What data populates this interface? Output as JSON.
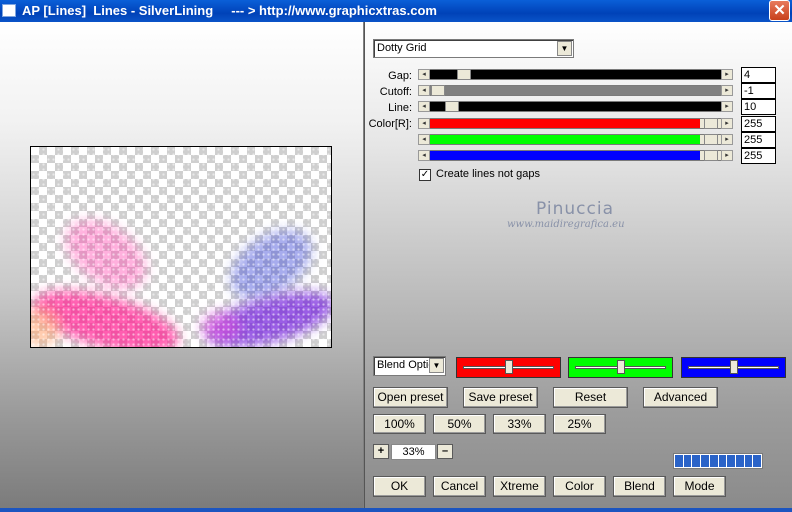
{
  "window": {
    "title": "AP [Lines]  Lines - SilverLining     --- > http://www.graphicxtras.com",
    "close_glyph": "✕"
  },
  "effect_select": {
    "value": "Dotty Grid"
  },
  "params": {
    "gap": {
      "label": "Gap:",
      "value": "4"
    },
    "cutoff": {
      "label": "Cutoff:",
      "value": "-1"
    },
    "line": {
      "label": "Line:",
      "value": "10"
    },
    "color": {
      "label": "Color[R]:",
      "r": "255",
      "g": "255",
      "b": "255"
    }
  },
  "option": {
    "label": "Create lines not gaps",
    "checked": true,
    "check_glyph": "✓"
  },
  "watermark": {
    "name": "Pinuccia",
    "site": "www.maidiregrafica.eu"
  },
  "blend_select": {
    "value": "Blend Optio"
  },
  "channel_sliders": {
    "red": {
      "color": "#ff0000",
      "level": 0.5
    },
    "green": {
      "color": "#00ff00",
      "level": 0.5
    },
    "blue": {
      "color": "#0000ff",
      "level": 0.5
    }
  },
  "buttons": {
    "open_preset": "Open preset",
    "save_preset": "Save preset",
    "reset": "Reset",
    "advanced": "Advanced",
    "zoom100": "100%",
    "zoom50": "50%",
    "zoom33": "33%",
    "zoom25": "25%",
    "zoom_in": "+",
    "zoom_out": "–",
    "ok": "OK",
    "cancel": "Cancel",
    "xtreme": "Xtreme",
    "color": "Color",
    "blend": "Blend",
    "mode": "Mode"
  },
  "zoom": {
    "value": "33%"
  },
  "arrows": {
    "down": "▼",
    "left": "◂",
    "right": "▸"
  },
  "colors": {
    "title_bar": "#0a54c8",
    "red": "#ff0000",
    "green": "#00ff00",
    "blue": "#0000ff"
  }
}
